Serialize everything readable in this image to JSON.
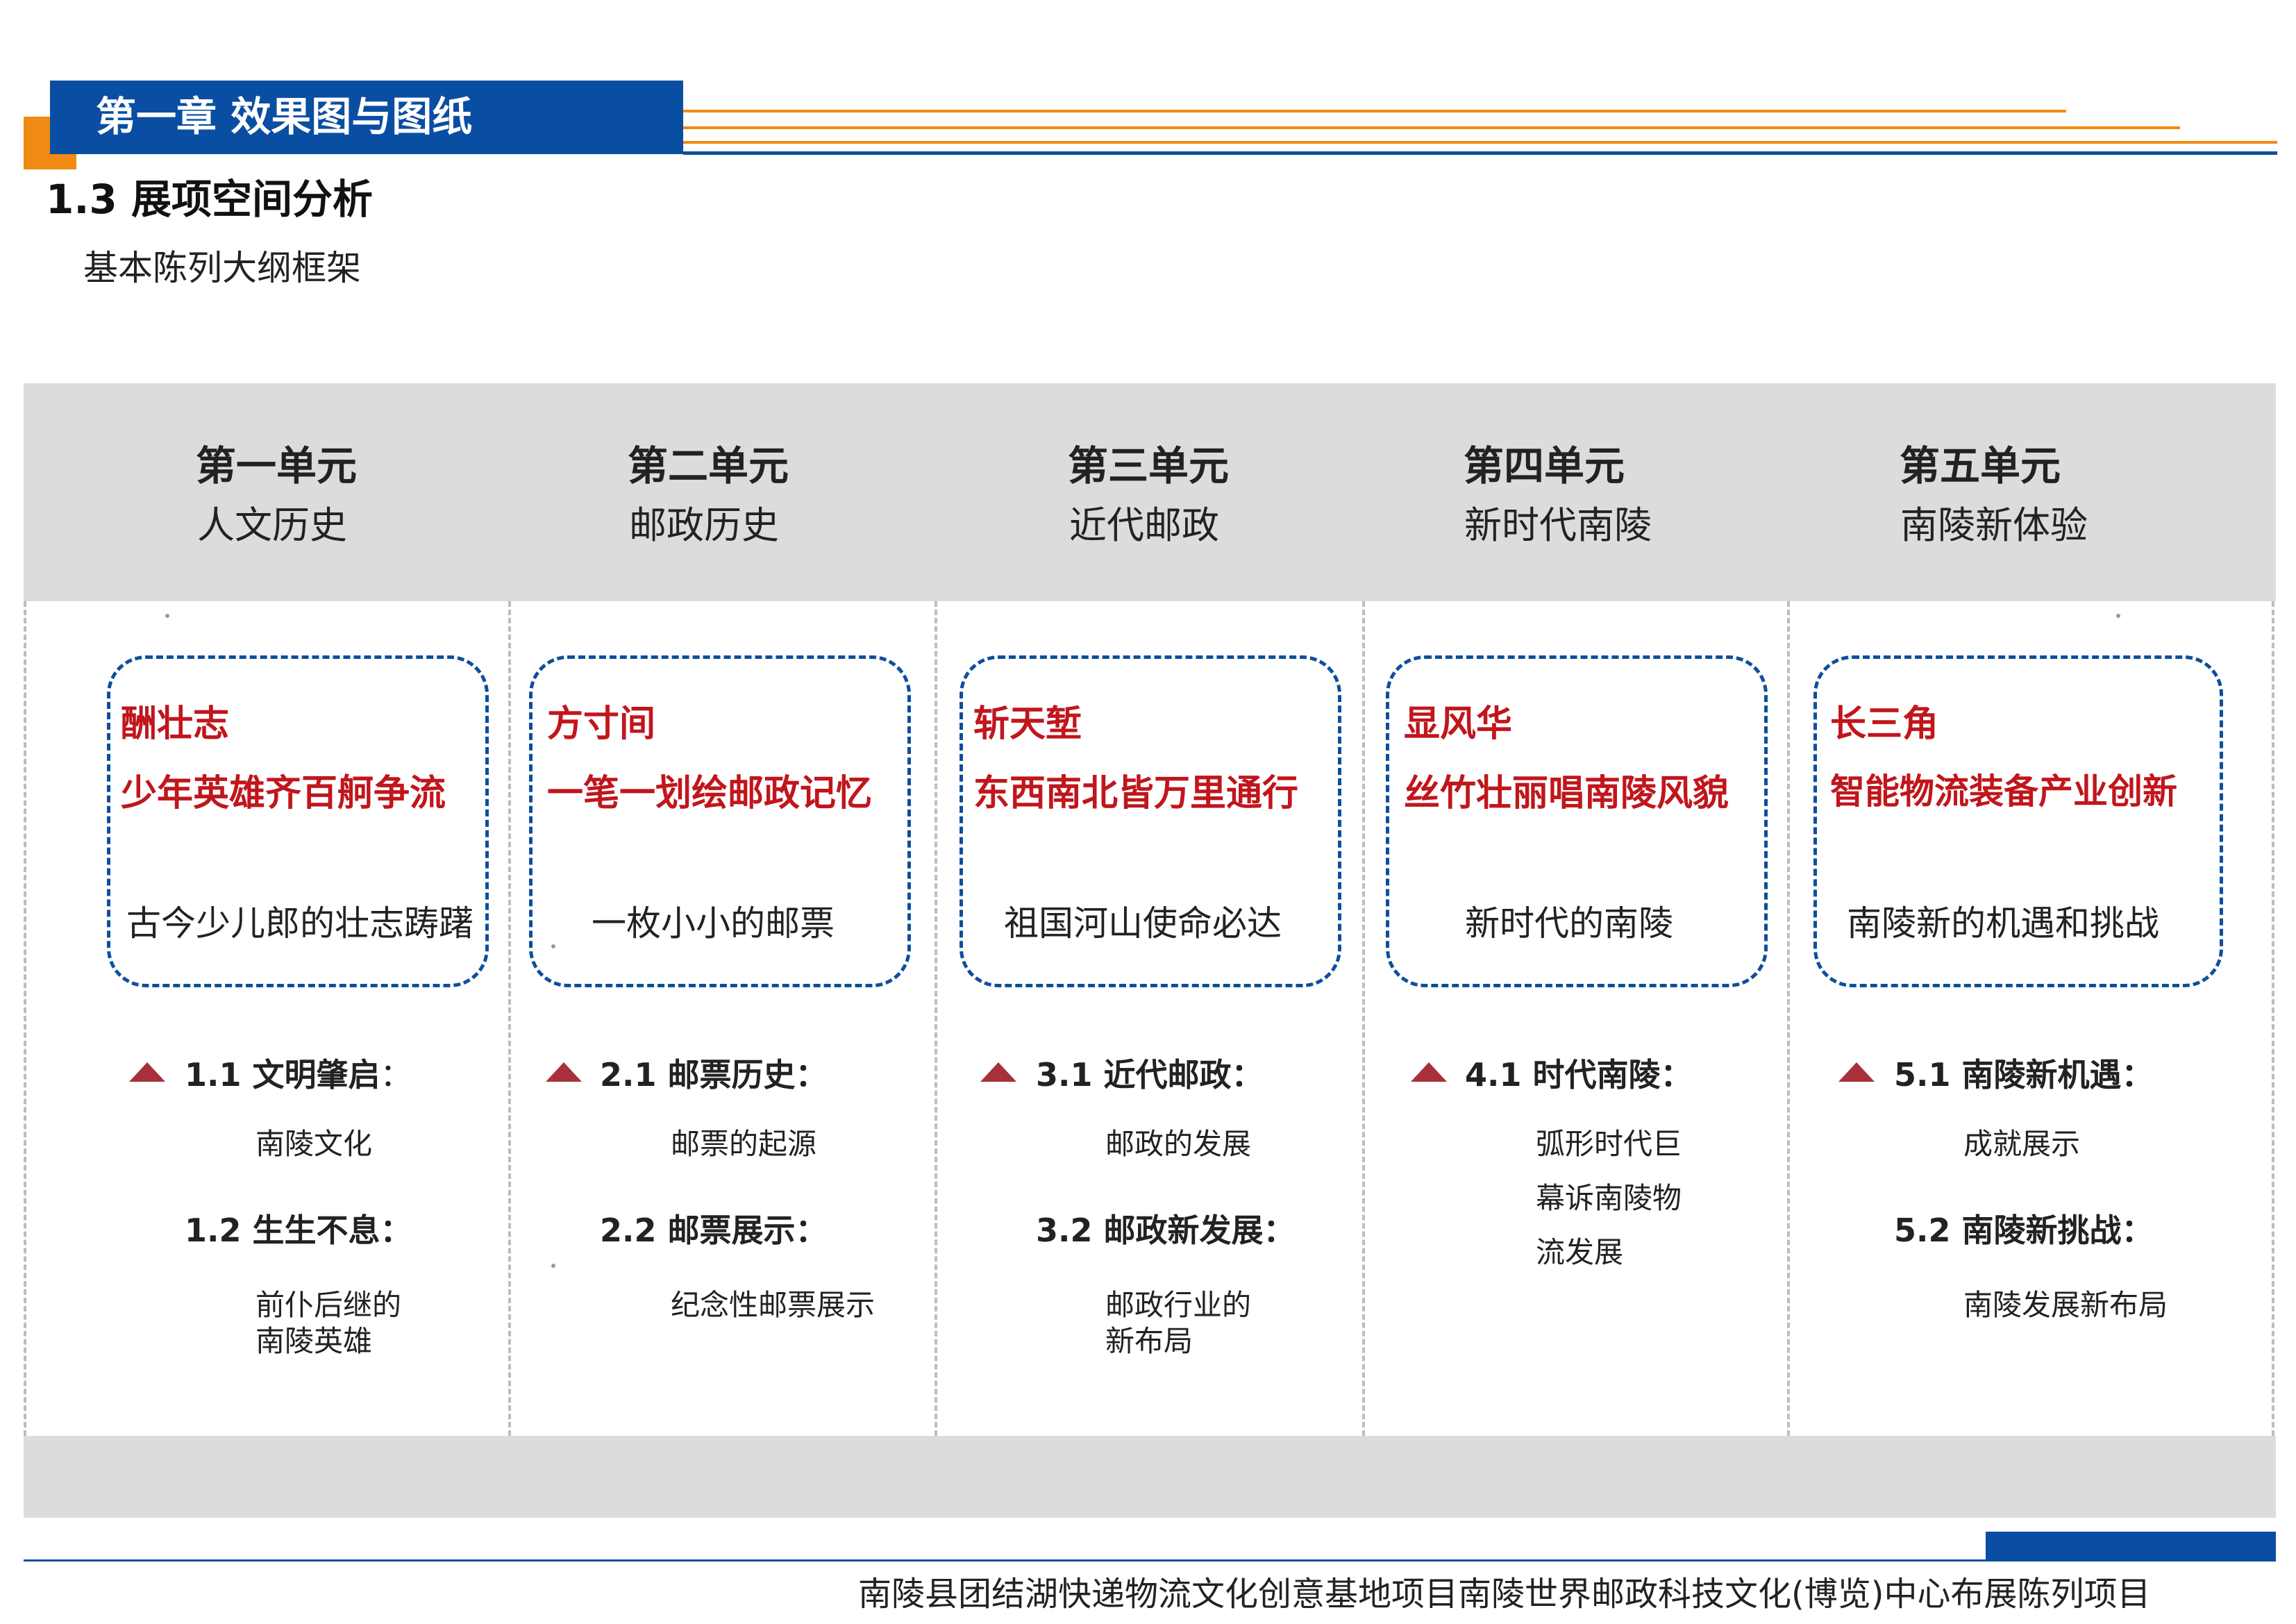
{
  "header": {
    "chapter": "第一章 效果图与图纸",
    "section": "1.3 展项空间分析",
    "subtitle": "基本陈列大纲框架",
    "colors": {
      "blue": "#0a4ea3",
      "orange": "#f08a12",
      "red": "#c0161c",
      "gray": "#dcdcdc"
    }
  },
  "units": [
    {
      "title": "第一单元",
      "sub": "人文历史",
      "box_title": "酬壮志",
      "box_slogan": "少年英雄齐百舸争流",
      "box_desc": "古今少儿郎的壮志踌躇",
      "s1_head": "1.1 文明肇启",
      "s1_colon": "：",
      "s1_body": "南陵文化",
      "s2_head": "1.2 生生不息：",
      "s2_body_a": "前仆后继的",
      "s2_body_b": "南陵英雄"
    },
    {
      "title": "第二单元",
      "sub": "邮政历史",
      "box_title": "方寸间",
      "box_slogan": "一笔一划绘邮政记忆",
      "box_desc": "一枚小小的邮票",
      "s1_head": "2.1 邮票历史：",
      "s1_body": "邮票的起源",
      "s2_head": "2.2 邮票展示：",
      "s2_body_a": "纪念性邮票展示"
    },
    {
      "title": "第三单元",
      "sub": "近代邮政",
      "box_title": "斩天堑",
      "box_slogan": "东西南北皆万里通行",
      "box_desc": "祖国河山使命必达",
      "s1_head": "3.1 近代邮政：",
      "s1_body": "邮政的发展",
      "s2_head": "3.2 邮政新发展：",
      "s2_body_a": "邮政行业的",
      "s2_body_b": "新布局"
    },
    {
      "title": "第四单元",
      "sub": "新时代南陵",
      "box_title": "显风华",
      "box_slogan": "丝竹壮丽唱南陵风貌",
      "box_desc": "新时代的南陵",
      "s1_head": "4.1 时代南陵：",
      "s1_body_a": "弧形时代巨",
      "s1_body_b": "幕诉南陵物",
      "s1_body_c": "流发展"
    },
    {
      "title": "第五单元",
      "sub": "南陵新体验",
      "box_title": "长三角",
      "box_slogan": "智能物流装备产业创新",
      "box_desc": "南陵新的机遇和挑战",
      "s1_head": "5.1 南陵新机遇：",
      "s1_body": "成就展示",
      "s2_head": "5.2 南陵新挑战：",
      "s2_body_a": "南陵发展新布局"
    }
  ],
  "footer": {
    "text": "南陵县团结湖快递物流文化创意基地项目南陵世界邮政科技文化(博览)中心布展陈列项目"
  },
  "icons": {
    "bullet": "triangle-up-icon"
  }
}
